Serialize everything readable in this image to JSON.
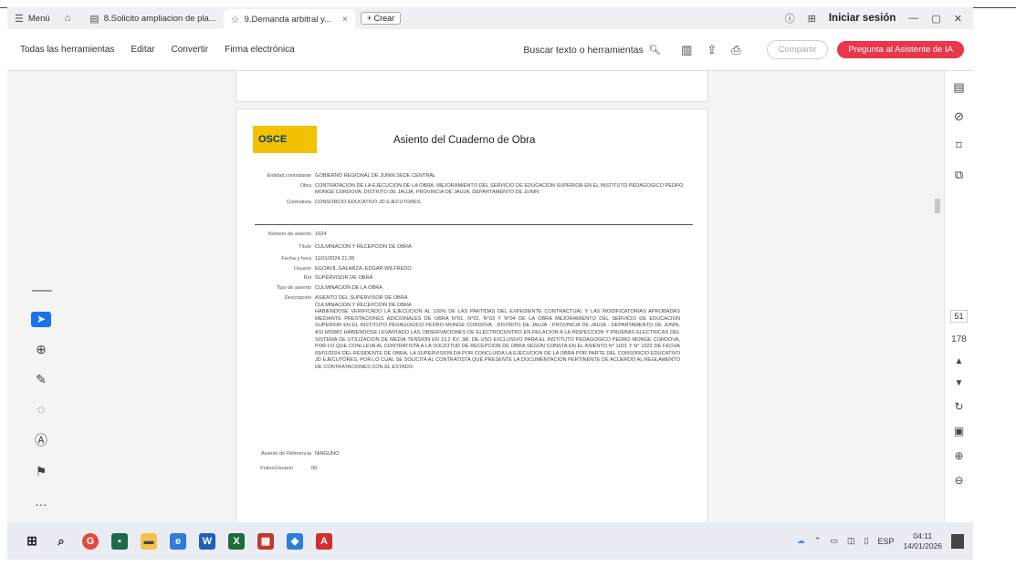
{
  "tabs": [
    {
      "icon": "home-icon",
      "label": ""
    },
    {
      "label": "8.Solicito ampliacion de pla..."
    },
    {
      "label": "9.Demanda arbitral y...",
      "close": "×"
    }
  ],
  "menu_label": "Menú",
  "new_label": "+ Crear",
  "signin_label": "Iniciar sesión",
  "window_controls": [
    "—",
    "▢",
    "✕"
  ],
  "toolbar": {
    "all_tools": "Todas las herramientas",
    "edit": "Editar",
    "convert": "Convertir",
    "sign": "Firma electrónica",
    "search": "Buscar texto o herramientas",
    "share": "Compartir",
    "ai": "Pregunta al Asistente de IA"
  },
  "doc": {
    "logo": "OSCE",
    "title": "Asiento del Cuaderno de Obra",
    "entity_label": "Entidad contratante",
    "entity": "GOBIERNO REGIONAL DE JUNIN SEDE CENTRAL",
    "work_label": "Obra",
    "work": "CONTRATACION DE LA EJECUCION DE LA OBRA: MEJORAMIENTO DEL SERVICIO DE EDUCACION SUPERIOR EN EL INSTITUTO PEDAGOGICO PEDRO MONGE CORDOVA, DISTRITO DE JAUJA, PROVINCIA DE JAUJA, DEPARTAMENTO DE JUNIN",
    "contractor_label": "Contratista",
    "contractor": "CONSORCIO EDUCATIVO JD EJECUTORES",
    "seat_label": "Número de asiento",
    "seat": "1024",
    "subject_label": "Título",
    "subject": "CULMINACION Y RECEPCION DE OBRA",
    "date_label": "Fecha y hora",
    "date": "11/01/2024 21:28",
    "user_label": "Usuario",
    "user": "EGOAVIL GALARZA, EDGAR WILFREDO",
    "role_label": "Rol",
    "role": "SUPERVISOR DE OBRA",
    "type_label": "Tipo de asiento",
    "type": "CULMINACION DE LA OBRA",
    "desc_label": "Descripción",
    "desc_head1": "ASIENTO DEL SUPERVISOR DE OBRA",
    "desc_head2": "CULMINACION Y RECEPCION DE OBRA",
    "desc_body": "HABIENDOSE VERIFICADO LA EJECUCION AL 100% DE LAS PARTIDAS DEL EXPEDIENTE CONTRACTUAL Y LAS MODIFICATORIAS APROBADAS MEDIANTE PRESTACIONES ADICIONALES DE OBRA N°01, N°02, N°03 Y N°04 DE LA OBRA MEJORAMIENTO DEL SERVICIO DE EDUCACION SUPERIOR EN EL INSTITUTO PEDAGOGICO PEDRO MONGE CORDOVA - DISTRITO DE JAUJA - PROVINCIA DE JAUJA - DEPARTAMENTO DE JUNIN, ASI MISMO HABIENDOSE LEVANTADO LAS OBSERVACIONES DE ELECTROCENTRO EN RELACION A LA INSPECCION Y PRUEBAS ELECTRICAS DEL SISTEMA DE UTILIZACION DE MEDIA TENSION EN 13.2 KV. 3Ø, DE USO EXCLUSIVO PARA EL INSTITUTO PEDAGOGICO PEDRO MONGE CORDOVA, POR LO QUE CONLLEVA AL CONTRATISTA A LA SOLICITUD DE RECEPCION DE OBRA SEGÚN CONSTA EN EL ASIENTO N° 1021 Y N° 1022 DE FECHA 09/01/2024 DEL RESIDENTE DE OBRA, LA SUPERVISION DA POR CONCLUIDA LA EJECUCION DE LA OBRA POR PARTE DEL CONSORCIO EDUCATIVO JD EJECUTORES, POR LO CUAL SE SOLICITA AL CONTRATISTA QUE PRESENTE LA DOCUMENTACION PERTINENTE DE ACUERDO AL REGLAMENTO DE CONTRATACIONES CON EL ESTADO.",
    "ref_label": "Asiento de Referencia",
    "ref": "NINGUNO",
    "folios_label": "Folios/Usuario",
    "folios": "00"
  },
  "page_current": "51",
  "page_total": "178",
  "tray": {
    "lang": "ESP",
    "time": "04:11",
    "date": "14/01/2026"
  },
  "colors": {
    "accent": "#1a73e8",
    "ai": "#e8364a",
    "logo": "#f2c200"
  }
}
